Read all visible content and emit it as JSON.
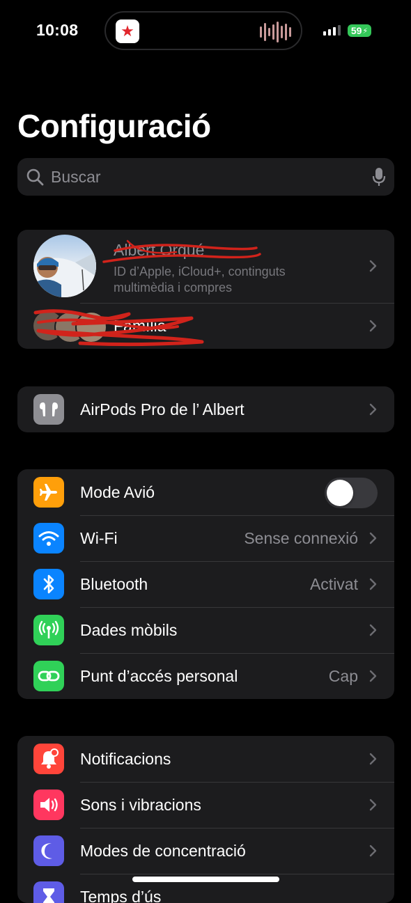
{
  "status_bar": {
    "time": "10:08",
    "battery": "59",
    "live_activity_icon": "radio-app-icon"
  },
  "header": {
    "title": "Configuració"
  },
  "search": {
    "placeholder": "Buscar"
  },
  "profile": {
    "name": "Albert Orqué",
    "subtitle": "ID d’Apple, iCloud+, continguts multimèdia i compres",
    "family_label": "Família"
  },
  "devices": [
    {
      "label": "AirPods Pro de l’ Albert",
      "icon": "airpods-icon",
      "color": "#8e8e93"
    }
  ],
  "connectivity": [
    {
      "label": "Mode Avió",
      "icon": "airplane-icon",
      "color": "#ff9f0a",
      "toggle": false
    },
    {
      "label": "Wi-Fi",
      "value": "Sense connexió",
      "icon": "wifi-icon",
      "color": "#0a84ff"
    },
    {
      "label": "Bluetooth",
      "value": "Activat",
      "icon": "bluetooth-icon",
      "color": "#0a84ff"
    },
    {
      "label": "Dades mòbils",
      "value": "",
      "icon": "antenna-icon",
      "color": "#30d158"
    },
    {
      "label": "Punt d’accés personal",
      "value": "Cap",
      "icon": "hotspot-icon",
      "color": "#30d158"
    }
  ],
  "notifications": [
    {
      "label": "Notificacions",
      "icon": "bell-icon",
      "color": "#ff453a"
    },
    {
      "label": "Sons i vibracions",
      "icon": "speaker-icon",
      "color": "#ff375f"
    },
    {
      "label": "Modes de concentració",
      "icon": "moon-icon",
      "color": "#5e5ce6"
    },
    {
      "label": "Temps d’ús",
      "icon": "hourglass-icon",
      "color": "#5e5ce6"
    }
  ],
  "colors": {
    "background": "#000000",
    "cell": "#1c1c1e",
    "secondary_text": "#8d8d93",
    "battery": "#34c759",
    "annotation_red": "#d1231b"
  }
}
